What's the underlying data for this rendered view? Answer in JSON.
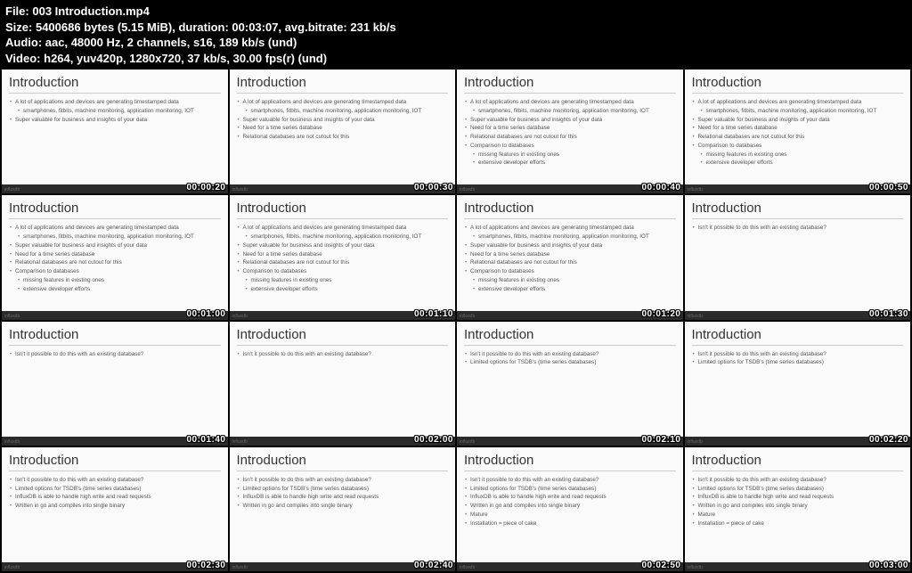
{
  "header": {
    "file_label": "File:",
    "file_value": "003 Introduction.mp4",
    "size_label": "Size:",
    "size_bytes": "5400686",
    "size_unit": "bytes",
    "size_human": "(5.15 MiB),",
    "dur_label": "duration:",
    "dur_value": "00:03:07,",
    "avg_label": "avg.bitrate:",
    "avg_value": "231 kb/s",
    "audio_label": "Audio:",
    "audio_value": "aac, 48000 Hz, 2 channels, s16, 189 kb/s (und)",
    "video_label": "Video:",
    "video_value": "h264, yuv420p, 1280x720, 37 kb/s, 30.00 fps(r) (und)"
  },
  "slide": {
    "title": "Introduction",
    "bullets": [
      {
        "t": "A lot of applications and devices are generating timestamped data",
        "sub": false
      },
      {
        "t": "smartphones, fitbits, machine monitoring, application monitoring, IOT",
        "sub": true
      },
      {
        "t": "Super valuable for business and insights of your data",
        "sub": false
      },
      {
        "t": "Need for a time series database",
        "sub": false
      },
      {
        "t": "Relational databases are not cutout for this",
        "sub": false
      },
      {
        "t": "Comparison to databases",
        "sub": false
      },
      {
        "t": "missing features in existing ones",
        "sub": true
      },
      {
        "t": "extensive developer efforts",
        "sub": true
      },
      {
        "t": "Isn't it possible to do this with an existing database?",
        "sub": false
      },
      {
        "t": "Limited options for TSDB's (time series databases)",
        "sub": false
      },
      {
        "t": "InfluxDB is able to handle high write and read requests",
        "sub": false
      },
      {
        "t": "Written in go and compiles into single binary",
        "sub": false
      },
      {
        "t": "Mature",
        "sub": false
      },
      {
        "t": "Installation = piece of cake",
        "sub": false
      }
    ]
  },
  "frames": [
    {
      "ts": "00:00:20",
      "start": 0,
      "count": 3
    },
    {
      "ts": "00:00:30",
      "start": 0,
      "count": 5
    },
    {
      "ts": "00:00:40",
      "start": 0,
      "count": 8
    },
    {
      "ts": "00:00:50",
      "start": 0,
      "count": 8
    },
    {
      "ts": "00:01:00",
      "start": 0,
      "count": 8
    },
    {
      "ts": "00:01:10",
      "start": 0,
      "count": 8
    },
    {
      "ts": "00:01:20",
      "start": 0,
      "count": 8
    },
    {
      "ts": "00:01:30",
      "start": 8,
      "count": 1
    },
    {
      "ts": "00:01:40",
      "start": 8,
      "count": 1
    },
    {
      "ts": "00:02:00",
      "start": 8,
      "count": 1
    },
    {
      "ts": "00:02:10",
      "start": 8,
      "count": 2
    },
    {
      "ts": "00:02:20",
      "start": 8,
      "count": 2
    },
    {
      "ts": "00:02:30",
      "start": 8,
      "count": 4
    },
    {
      "ts": "00:02:40",
      "start": 8,
      "count": 4
    },
    {
      "ts": "00:02:50",
      "start": 8,
      "count": 6
    },
    {
      "ts": "00:03:00",
      "start": 8,
      "count": 6
    }
  ],
  "brand": "influxdb"
}
